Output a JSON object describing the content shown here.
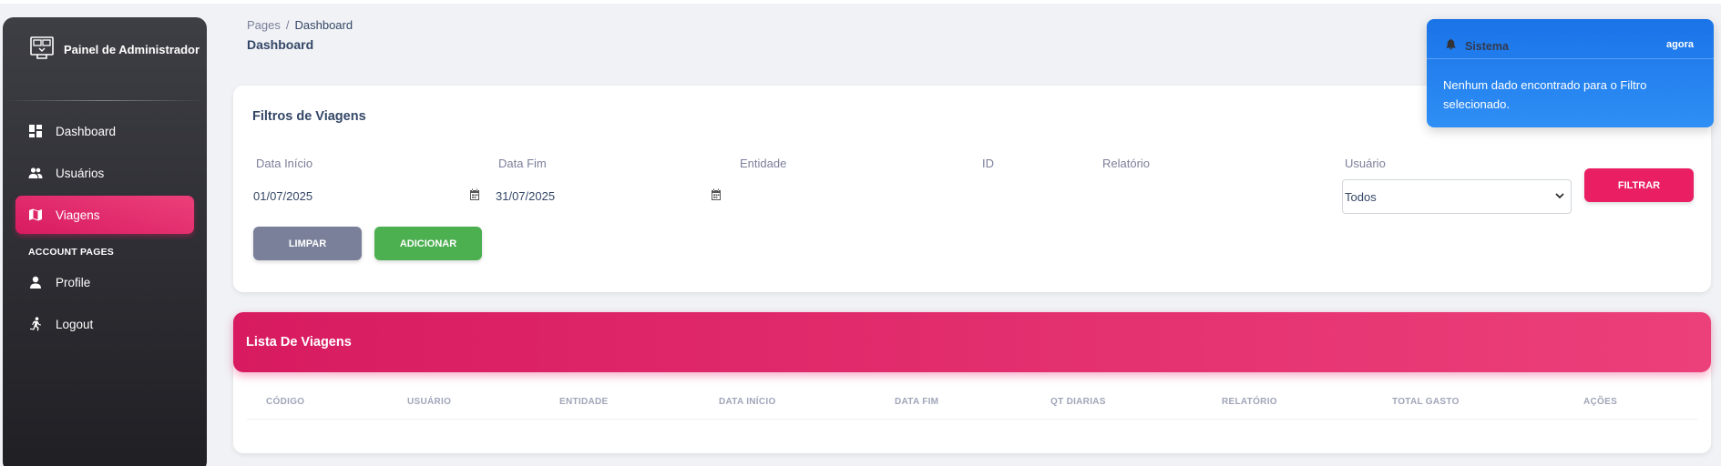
{
  "sidebar": {
    "brand": "Painel de Administrador",
    "items": [
      {
        "label": "Dashboard",
        "icon": "dashboard-icon"
      },
      {
        "label": "Usuários",
        "icon": "users-icon"
      },
      {
        "label": "Viagens",
        "icon": "map-icon",
        "active": true
      }
    ],
    "section_title": "ACCOUNT PAGES",
    "account_items": [
      {
        "label": "Profile",
        "icon": "person-icon"
      },
      {
        "label": "Logout",
        "icon": "logout-run-icon"
      }
    ]
  },
  "header": {
    "breadcrumb_root": "Pages",
    "breadcrumb_sep": "/",
    "breadcrumb_current": "Dashboard",
    "title": "Dashboard"
  },
  "filters": {
    "title": "Filtros de Viagens",
    "data_inicio_label": "Data Início",
    "data_inicio_value": "01/07/2025",
    "data_fim_label": "Data Fim",
    "data_fim_value": "31/07/2025",
    "entidade_label": "Entidade",
    "id_label": "ID",
    "relatorio_label": "Relatório",
    "usuario_label": "Usuário",
    "usuario_selected": "Todos",
    "filtrar_label": "FILTRAR",
    "limpar_label": "LIMPAR",
    "adicionar_label": "ADICIONAR"
  },
  "list": {
    "title": "Lista De Viagens",
    "columns": [
      "CÓDIGO",
      "USUÁRIO",
      "ENTIDADE",
      "DATA INÍCIO",
      "DATA FIM",
      "QT DIARIAS",
      "RELATÓRIO",
      "TOTAL GASTO",
      "AÇÕES"
    ],
    "rows": []
  },
  "toast": {
    "title": "Sistema",
    "time": "agora",
    "message": "Nenhum dado encontrado para o Filtro selecionado."
  },
  "colors": {
    "accent": "#e91e63",
    "info": "#1a73e8",
    "success": "#4caf50",
    "secondary": "#7b809a",
    "sidebar": "#2b2b31"
  }
}
